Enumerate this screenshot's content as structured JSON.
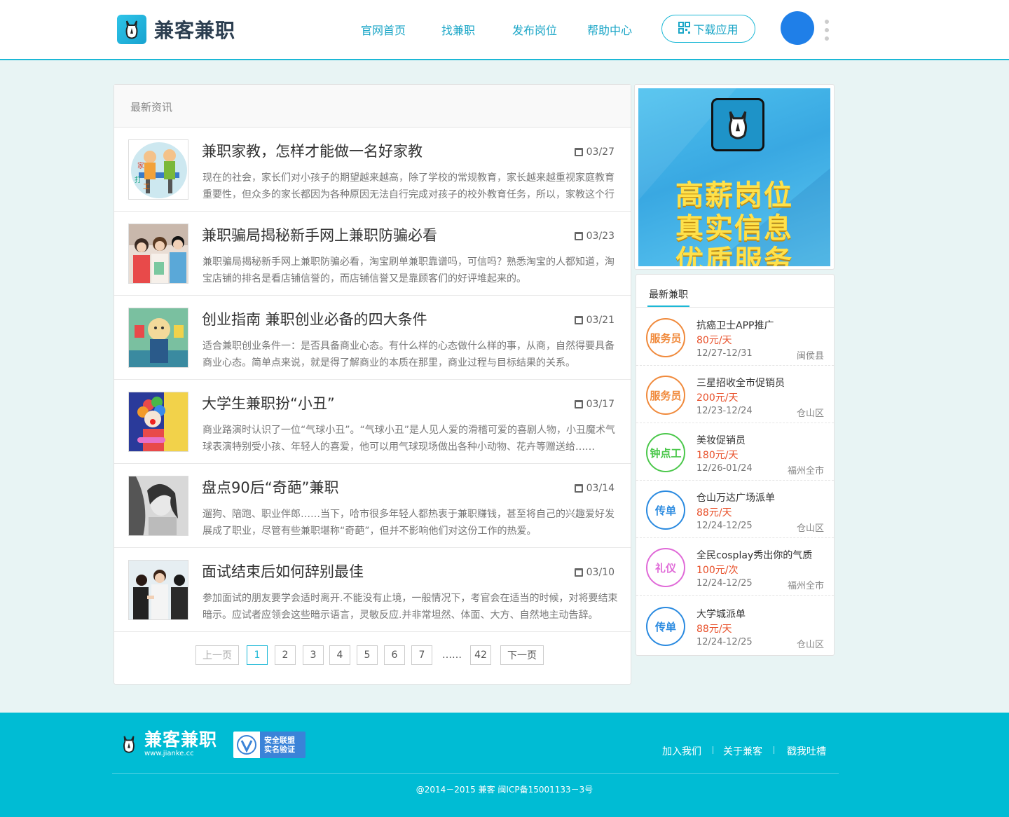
{
  "header": {
    "brand": "兼客兼职",
    "nav": [
      {
        "label": "官网首页"
      },
      {
        "label": "找兼职"
      },
      {
        "label": "发布岗位"
      },
      {
        "label": "帮助中心"
      }
    ],
    "download_label": "下载应用",
    "colors": {
      "accent": "#1cb8d6",
      "avatar": "#1f7fe8"
    }
  },
  "news": {
    "heading": "最新资讯",
    "items": [
      {
        "title": "兼职家教，怎样才能做一名好家教",
        "date": "03/27",
        "desc": "现在的社会，家长们对小孩子的期望越来越高，除了学校的常规教育，家长越来越重视家庭教育重要性，但众多的家长都因为各种原因无法自行完成对孩子的校外教育任务，所以，家教这个行",
        "thumb": "tutor-cartoon"
      },
      {
        "title": "兼职骗局揭秘新手网上兼职防骗必看",
        "date": "03/23",
        "desc": "兼职骗局揭秘新手网上兼职防骗必看，淘宝刷单兼职靠谱吗，可信吗？熟悉淘宝的人都知道，淘宝店铺的排名是看店铺信誉的，而店铺信誉又是靠顾客们的好评堆起来的。",
        "thumb": "people-photo"
      },
      {
        "title": "创业指南 兼职创业必备的四大条件",
        "date": "03/21",
        "desc": "适合兼职创业条件一：是否具备商业心态。有什么样的心态做什么样的事，从商，自然得要具备商业心态。简单点来说，就是得了解商业的本质在那里，商业过程与目标结果的关系。",
        "thumb": "business-cartoon"
      },
      {
        "title": "大学生兼职扮“小丑”",
        "date": "03/17",
        "desc": "商业路演时认识了一位“气球小丑”。“气球小丑”是人见人爱的滑稽可爱的喜剧人物，小丑魔术气球表演特别受小孩、年轻人的喜爱，他可以用气球现场做出各种小动物、花卉等赠送给……",
        "thumb": "clown-photo"
      },
      {
        "title": "盘点90后“奇葩”兼职",
        "date": "03/14",
        "desc": "遛狗、陪跑、职业伴郎……当下，哈市很多年轻人都热衷于兼职赚钱，甚至将自己的兴趣爱好发展成了职业，尽管有些兼职堪称“奇葩”，但并不影响他们对这份工作的热爱。",
        "thumb": "bw-portrait"
      },
      {
        "title": "面试结束后如何辞别最佳",
        "date": "03/10",
        "desc": "参加面试的朋友要学会适时离开.不能没有止境，一般情况下，考官会在适当的时候，对将要结束暗示。应试者应领会这些暗示语言，灵敏反应.并非常坦然、体面、大方、自然地主动告辞。",
        "thumb": "interview-photo"
      }
    ],
    "pager": {
      "prev": "上一页",
      "pages": [
        "1",
        "2",
        "3",
        "4",
        "5",
        "6",
        "7"
      ],
      "ellipsis": "……",
      "last": "42",
      "next": "下一页",
      "current": "1"
    }
  },
  "banner": {
    "lines": [
      "高薪岗位",
      "真实信息",
      "优质服务"
    ]
  },
  "jobs": {
    "heading": "最新兼职",
    "items": [
      {
        "badge": "服务员",
        "badge_color": "#f08a3c",
        "title": "抗癌卫士APP推广",
        "pay": "80元/天",
        "date": "12/27-12/31",
        "location": "闽侯县"
      },
      {
        "badge": "服务员",
        "badge_color": "#f08a3c",
        "title": "三星招收全市促销员",
        "pay": "200元/天",
        "date": "12/23-12/24",
        "location": "仓山区"
      },
      {
        "badge": "钟点工",
        "badge_color": "#4cc84c",
        "title": "美妆促销员",
        "pay": "180元/天",
        "date": "12/26-01/24",
        "location": "福州全市"
      },
      {
        "badge": "传单",
        "badge_color": "#2a8ae0",
        "title": "仓山万达广场派单",
        "pay": "88元/天",
        "date": "12/24-12/25",
        "location": "仓山区"
      },
      {
        "badge": "礼仪",
        "badge_color": "#e06ad8",
        "title": "全民cosplay秀出你的气质",
        "pay": "100元/次",
        "date": "12/24-12/25",
        "location": "福州全市"
      },
      {
        "badge": "传单",
        "badge_color": "#2a8ae0",
        "title": "大学城派单",
        "pay": "88元/天",
        "date": "12/24-12/25",
        "location": "仓山区"
      }
    ]
  },
  "footer": {
    "brand": "兼客兼职",
    "url": "www.jianke.cc",
    "badge_line1": "安全联盟",
    "badge_line2": "实名验证",
    "links": [
      {
        "label": "加入我们"
      },
      {
        "label": "关于兼客"
      },
      {
        "label": "戳我吐槽"
      }
    ],
    "copyright": "@2014－2015  兼客  闽ICP备15001133－3号",
    "color": "#00bcd4"
  }
}
